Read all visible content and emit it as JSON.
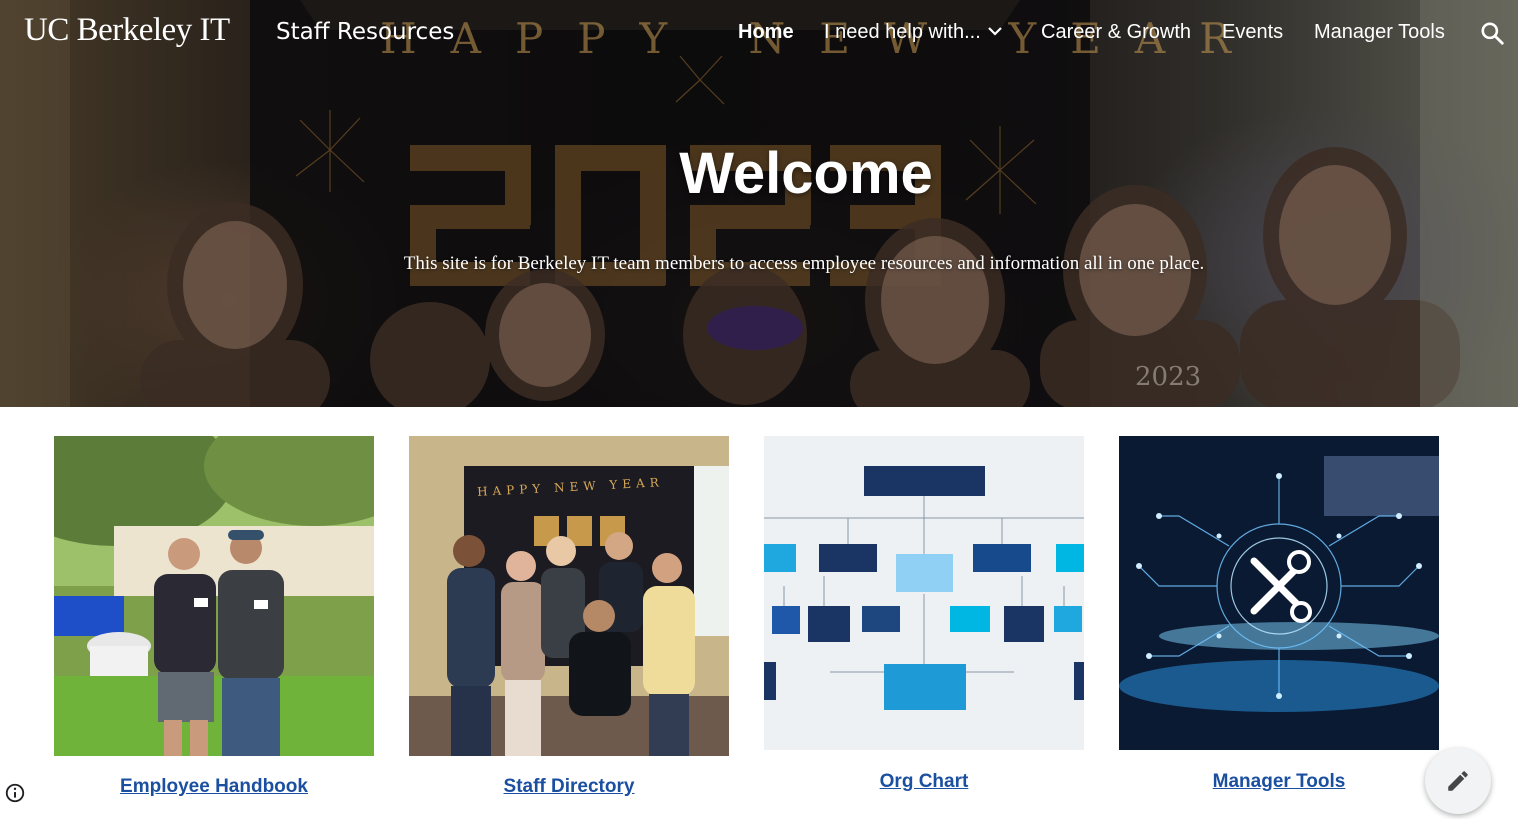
{
  "header": {
    "brand": "UC Berkeley IT",
    "site_title": "Staff Resources",
    "nav": [
      {
        "label": "Home",
        "active": true
      },
      {
        "label": "I need help with...",
        "has_dropdown": true
      },
      {
        "label": "Career & Growth"
      },
      {
        "label": "Events"
      },
      {
        "label": "Manager Tools"
      }
    ],
    "search_icon": "search-icon"
  },
  "hero": {
    "heading": "Welcome",
    "subtitle": "This site is for Berkeley IT team members to access employee resources and information all in one place.",
    "banner_letters": "HAPPY NEW YEAR",
    "banner_year": "2023"
  },
  "cards": [
    {
      "label": "Employee Handbook",
      "image": "two-staff-outdoors-photo"
    },
    {
      "label": "Staff Directory",
      "image": "new-year-group-photo",
      "banner_letters": "HAPPY NEW YEAR",
      "banner_year": "2023"
    },
    {
      "label": "Org Chart",
      "image": "org-chart-diagram"
    },
    {
      "label": "Manager Tools",
      "image": "tools-circuit-graphic"
    }
  ],
  "colors": {
    "link": "#1b4fa0",
    "navy": "#1a3563",
    "sky": "#8fd0f4",
    "cyan": "#00b7e3",
    "fab": "#f1f3f4"
  },
  "icons": {
    "info": "info-icon",
    "edit": "pencil-icon"
  }
}
